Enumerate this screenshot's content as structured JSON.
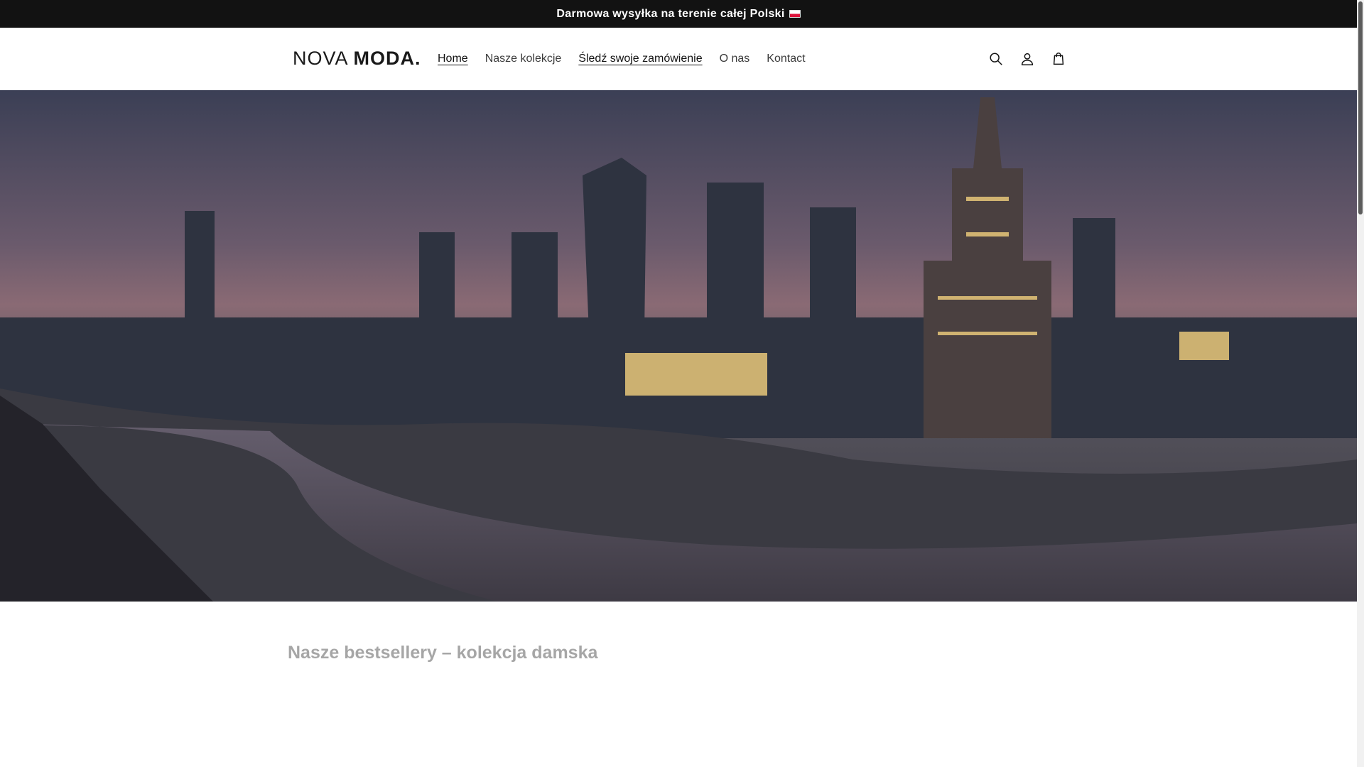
{
  "announcement": {
    "text": "Darmowa wysyłka na terenie całej Polski",
    "flag_icon": "poland-flag-icon"
  },
  "header": {
    "logo_light": "NOVA",
    "logo_bold": "MODA.",
    "nav": [
      {
        "label": "Home"
      },
      {
        "label": "Nasze kolekcje"
      },
      {
        "label": "Śledź swoje zamówienie"
      },
      {
        "label": "O nas"
      },
      {
        "label": "Kontact"
      }
    ],
    "icons": [
      "search-icon",
      "account-icon",
      "cart-icon"
    ]
  },
  "hero": {
    "image": "warsaw-skyline-at-dusk"
  },
  "section": {
    "title": "Nasze bestsellery – kolekcja damska"
  },
  "colors": {
    "announcement_bg": "#121212",
    "text": "#121212",
    "section_title": "#a6a6a6"
  }
}
